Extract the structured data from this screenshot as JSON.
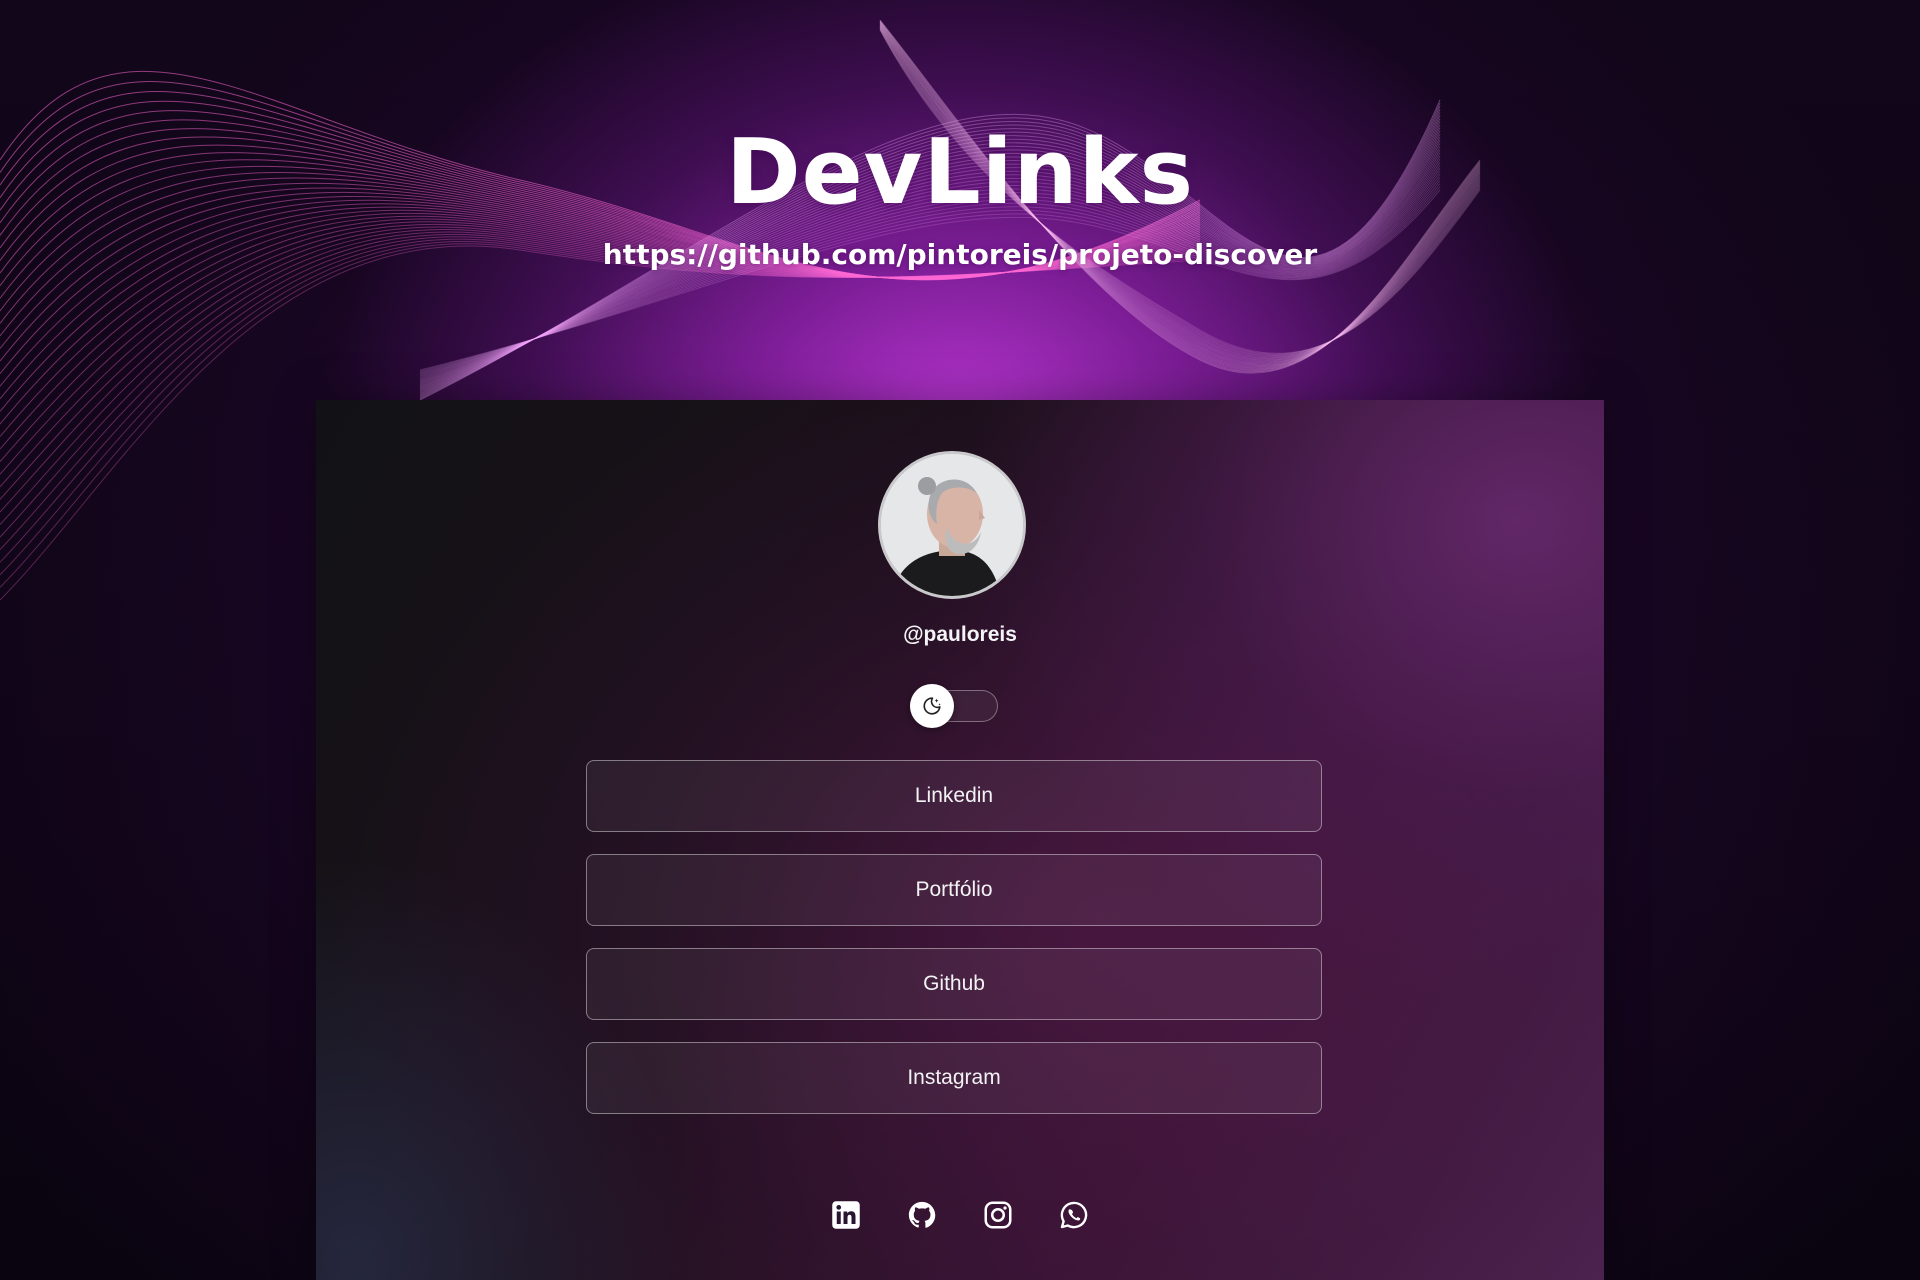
{
  "hero": {
    "title": "DevLinks",
    "url": "https://github.com/pintoreis/projeto-discover"
  },
  "profile": {
    "handle": "@pauloreis",
    "avatar_icon": "profile-photo"
  },
  "theme_toggle": {
    "icon": "moon-stars-icon",
    "mode": "dark"
  },
  "links": [
    {
      "label": "Linkedin"
    },
    {
      "label": "Portfólio"
    },
    {
      "label": "Github"
    },
    {
      "label": "Instagram"
    }
  ],
  "socials": [
    {
      "icon": "linkedin-icon"
    },
    {
      "icon": "github-icon"
    },
    {
      "icon": "instagram-icon"
    },
    {
      "icon": "whatsapp-icon"
    }
  ],
  "colors": {
    "accent": "#b43ad4",
    "text": "#ffffff",
    "card_dark": "#121216"
  }
}
